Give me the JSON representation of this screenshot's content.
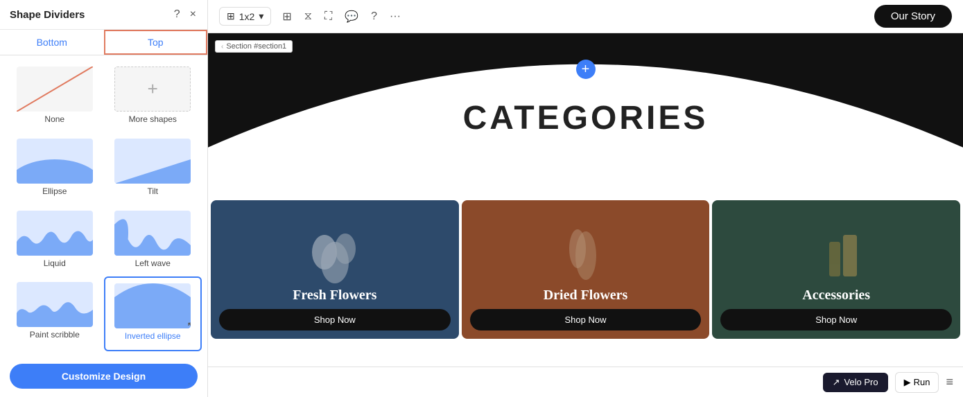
{
  "panel": {
    "title": "Shape Dividers",
    "help_icon": "?",
    "close_icon": "×",
    "tabs": [
      {
        "id": "bottom",
        "label": "Bottom",
        "active": false
      },
      {
        "id": "top",
        "label": "Top",
        "active": true
      }
    ],
    "shapes": [
      {
        "id": "none",
        "label": "None",
        "type": "none"
      },
      {
        "id": "more-shapes",
        "label": "More shapes",
        "type": "more"
      },
      {
        "id": "ellipse",
        "label": "Ellipse",
        "type": "ellipse"
      },
      {
        "id": "tilt",
        "label": "Tilt",
        "type": "tilt"
      },
      {
        "id": "liquid",
        "label": "Liquid",
        "type": "liquid"
      },
      {
        "id": "leftwave",
        "label": "Left wave",
        "type": "leftwave"
      },
      {
        "id": "paintscribble",
        "label": "Paint scribble",
        "type": "paintscribble"
      },
      {
        "id": "inverted-ellipse",
        "label": "Inverted ellipse",
        "type": "inverted-ellipse",
        "selected": true
      }
    ],
    "customize_btn_label": "Customize Design"
  },
  "topbar": {
    "layout": "1x2",
    "nav_btn_label": "Our Story"
  },
  "canvas": {
    "section_label": "Section #section1",
    "categories_text": "CATEGORIES",
    "plus_symbol": "+",
    "cards": [
      {
        "id": "fresh-flowers",
        "title": "Fresh Flowers",
        "btn_label": "Shop Now",
        "bg_class": "card-bg-blue"
      },
      {
        "id": "dried-flowers",
        "title": "Dried Flowers",
        "btn_label": "Shop Now",
        "bg_class": "card-bg-brown"
      },
      {
        "id": "accessories",
        "title": "Accessories",
        "btn_label": "Shop Now",
        "bg_class": "card-bg-green"
      }
    ]
  },
  "bottombar": {
    "velo_pro_label": "Velo Pro",
    "run_label": "Run"
  }
}
